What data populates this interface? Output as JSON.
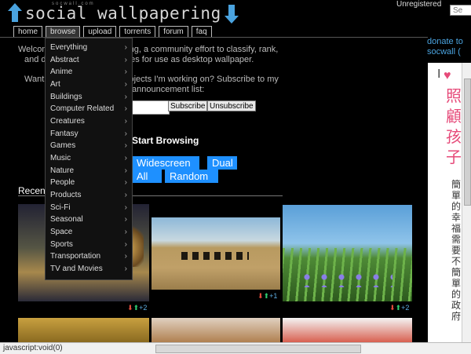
{
  "header": {
    "logo_small": "socwall.com",
    "logo_text": "social wallpapering",
    "user_status": "Unregistered",
    "login_placeholder": "Se"
  },
  "nav": [
    "home",
    "browse",
    "upload",
    "torrents",
    "forum",
    "faq"
  ],
  "intro": {
    "p1a": "Welcome to social wallpapering, a community effort to classify, rank,",
    "p1b": "and distribute the best images for use as desktop wallpaper.",
    "p2a": "Want to keep up with the projects I'm working on? Subscribe to my",
    "p2b": "announcement list:",
    "subscribe": "Subscribe",
    "unsubscribe": "Unsubscribe"
  },
  "browse": {
    "heading": "Start Browsing",
    "buttons": [
      "Widescreen",
      "Dual",
      "All",
      "Random"
    ]
  },
  "recent": {
    "label": "Recent",
    "votes": [
      "+2",
      "+1",
      "+2"
    ]
  },
  "right": {
    "donate_1": "donate to",
    "donate_2": "socwall (",
    "ad_big": "照顧孩子",
    "ad_small": "簡單的幸福需要不簡單的政府"
  },
  "dropdown": [
    "Everything",
    "Abstract",
    "Anime",
    "Art",
    "Buildings",
    "Computer Related",
    "Creatures",
    "Fantasy",
    "Games",
    "Music",
    "Nature",
    "People",
    "Products",
    "Sci-Fi",
    "Seasonal",
    "Space",
    "Sports",
    "Transportation",
    "TV and Movies"
  ],
  "status_bar": "javascript:void(0)",
  "colors": {
    "accent": "#1e90ff",
    "background": "#000000"
  },
  "icons": [
    "upload-arrow-icon",
    "download-arrow-icon",
    "vote-down-icon",
    "vote-up-icon",
    "submenu-arrow-icon"
  ]
}
